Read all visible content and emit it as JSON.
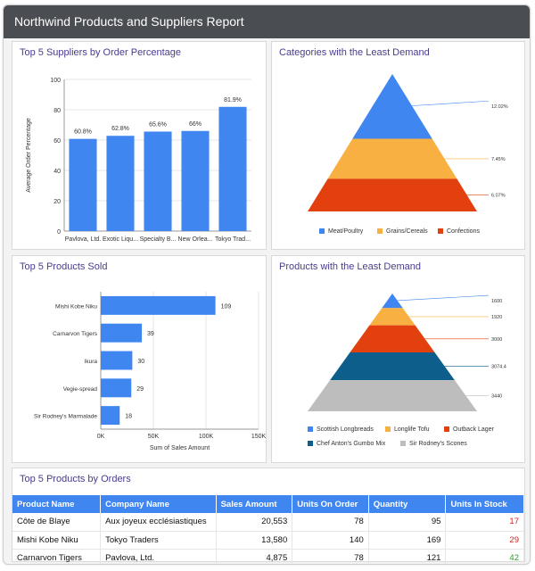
{
  "report_title": "Northwind Products and Suppliers Report",
  "colors": {
    "header": "#4a4d52",
    "blue": "#3f86f0",
    "orange": "#f9b042",
    "red": "#e2400f",
    "dark_blue": "#0e5e8c",
    "grey": "#bdbdbd",
    "title_purple": "#4b3b8c"
  },
  "panels": {
    "suppliers": "Top 5 Suppliers by Order Percentage",
    "categories": "Categories with the Least Demand",
    "products_sold": "Top 5 Products Sold",
    "least_products": "Products with the Least Demand",
    "orders": "Top 5 Products by Orders"
  },
  "chart_data": [
    {
      "type": "bar",
      "title": "Top 5 Suppliers by Order Percentage",
      "categories": [
        "Pavlova, Ltd.",
        "Exotic Liqu...",
        "Specialty B...",
        "New Orlea...",
        "Tokyo Trad..."
      ],
      "values": [
        60.8,
        62.8,
        65.6,
        66,
        81.9
      ],
      "data_labels": [
        "60.8%",
        "62.8%",
        "65.6%",
        "66%",
        "81.9%"
      ],
      "ylabel": "Average Order Percentage",
      "ylim": [
        0,
        100
      ],
      "yticks": [
        "0",
        "20",
        "40",
        "60",
        "80",
        "100"
      ],
      "color": "#3f86f0"
    },
    {
      "type": "pyramid",
      "title": "Categories with the Least Demand",
      "categories": [
        "Meat/Poultry",
        "Grains/Cereals",
        "Confections"
      ],
      "values": [
        12.02,
        7.45,
        6.07
      ],
      "data_labels": [
        "12.02%",
        "7.45%",
        "6.07%"
      ],
      "colors": [
        "#3f86f0",
        "#f9b042",
        "#e2400f"
      ],
      "legend": "bottom"
    },
    {
      "type": "bar",
      "orientation": "horizontal",
      "title": "Top 5 Products Sold",
      "categories": [
        "Mishi Kobe Niku",
        "Carnarvon Tigers",
        "Ikura",
        "Vegie-spread",
        "Sir Rodney's Marmalade"
      ],
      "values": [
        109,
        39,
        30,
        29,
        18
      ],
      "data_labels": [
        "109",
        "39",
        "30",
        "29",
        "18"
      ],
      "xlabel": "Sum of Sales Amount",
      "xticks": [
        "0K",
        "50K",
        "100K",
        "150K"
      ],
      "color": "#3f86f0"
    },
    {
      "type": "pyramid",
      "title": "Products with the Least Demand",
      "categories": [
        "Scottish Longbreads",
        "Longlife Tofu",
        "Outback Lager",
        "Chef Anton's Gumbo Mix",
        "Sir Rodney's Scones"
      ],
      "values": [
        1600,
        1920,
        3000,
        3074.4,
        3440
      ],
      "data_labels": [
        "1600",
        "1920",
        "3000",
        "3074.4",
        "3440"
      ],
      "colors": [
        "#3f86f0",
        "#f9b042",
        "#e2400f",
        "#0e5e8c",
        "#bdbdbd"
      ],
      "legend": "bottom"
    }
  ],
  "orders_table": {
    "title": "Top 5 Products by Orders",
    "columns": [
      "Product Name",
      "Company Name",
      "Sales Amount",
      "Units On Order",
      "Quantity",
      "Units In Stock"
    ],
    "rows": [
      [
        "Côte de Blaye",
        "Aux joyeux ecclésiastiques",
        "20,553",
        "78",
        "95",
        "17"
      ],
      [
        "Mishi Kobe Niku",
        "Tokyo Traders",
        "13,580",
        "140",
        "169",
        "29"
      ],
      [
        "Carnarvon Tigers",
        "Pavlova, Ltd.",
        "4,875",
        "78",
        "121",
        "42"
      ]
    ]
  }
}
